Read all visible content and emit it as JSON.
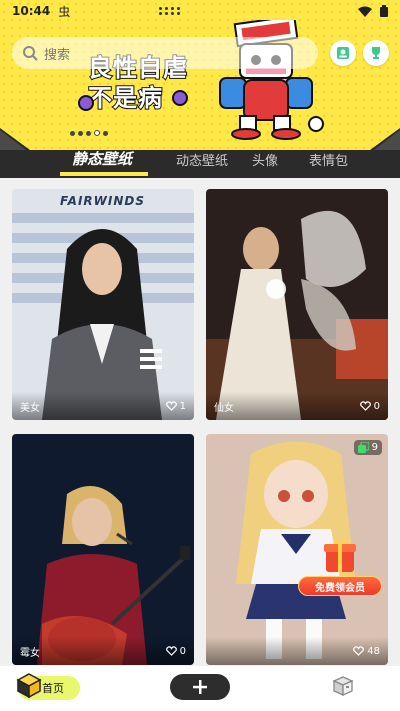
{
  "status": {
    "time": "10:44",
    "app_glyph": "虫"
  },
  "banner": {
    "headline_line1": "良性自虐",
    "headline_line2": "不是病",
    "pages": 5,
    "active_page": 3
  },
  "search": {
    "placeholder": "搜索"
  },
  "header_icons": [
    "person-card-icon",
    "trophy-icon"
  ],
  "tabs": [
    {
      "label": "静态壁纸",
      "active": true
    },
    {
      "label": "动态壁纸",
      "active": false
    },
    {
      "label": "头像",
      "active": false
    },
    {
      "label": "表情包",
      "active": false
    }
  ],
  "cards": [
    {
      "title": "美女",
      "likes": "1"
    },
    {
      "title": "仙女",
      "likes": "0"
    },
    {
      "title": "霉女",
      "likes": "0"
    },
    {
      "title": "",
      "likes": "48",
      "badge": "9"
    }
  ],
  "card1_sign": "FAIRWINDS",
  "gift_label": "免费领会员",
  "bottom_nav": {
    "home": "首页"
  },
  "colors": {
    "banner_yellow": "#ffe84a",
    "tabbar_dark": "#2b2b2b",
    "home_pill": "#e8f76b",
    "gift_red": "#f03a2a"
  }
}
